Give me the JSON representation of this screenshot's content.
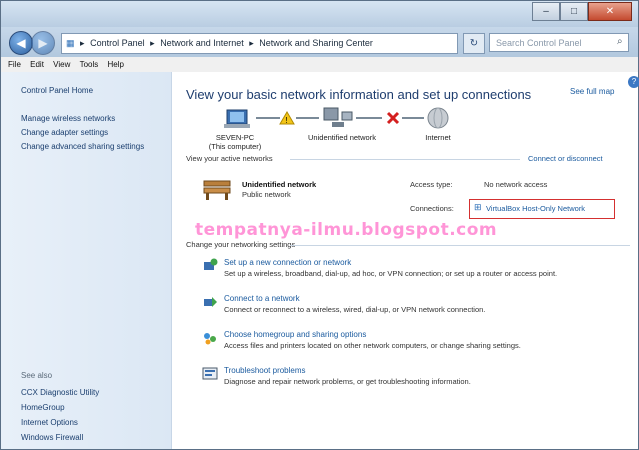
{
  "window": {
    "min": "–",
    "max": "□",
    "close": "✕"
  },
  "nav": {
    "breadcrumbs": [
      "Control Panel",
      "Network and Internet",
      "Network and Sharing Center"
    ],
    "search_placeholder": "Search Control Panel"
  },
  "menu": [
    "File",
    "Edit",
    "View",
    "Tools",
    "Help"
  ],
  "sidebar": {
    "home": "Control Panel Home",
    "links": [
      "Manage wireless networks",
      "Change adapter settings",
      "Change advanced sharing settings"
    ],
    "see_also_label": "See also",
    "see_also": [
      "CCX Diagnostic Utility",
      "HomeGroup",
      "Internet Options",
      "Windows Firewall"
    ]
  },
  "main": {
    "title": "View your basic network information and set up connections",
    "see_full_map": "See full map",
    "map": {
      "computer_name": "SEVEN-PC",
      "computer_sub": "(This computer)",
      "network_label": "Unidentified network",
      "internet_label": "Internet"
    },
    "active_networks_label": "View your active networks",
    "connect_disconnect": "Connect or disconnect",
    "network": {
      "name": "Unidentified network",
      "type": "Public network",
      "access_type_label": "Access type:",
      "access_type_value": "No network access",
      "connections_label": "Connections:",
      "connections_value": "VirtualBox Host-Only Network"
    },
    "watermark": "tempatnya-ilmu.blogspot.com",
    "change_settings_label": "Change your networking settings",
    "tasks": [
      {
        "title": "Set up a new connection or network",
        "desc": "Set up a wireless, broadband, dial-up, ad hoc, or VPN connection; or set up a router or access point."
      },
      {
        "title": "Connect to a network",
        "desc": "Connect or reconnect to a wireless, wired, dial-up, or VPN network connection."
      },
      {
        "title": "Choose homegroup and sharing options",
        "desc": "Access files and printers located on other network computers, or change sharing settings."
      },
      {
        "title": "Troubleshoot problems",
        "desc": "Diagnose and repair network problems, or get troubleshooting information."
      }
    ]
  },
  "colors": {
    "accent": "#1a5a9e",
    "title": "#1e3d6e",
    "highlight_box": "#d43030",
    "watermark": "#ff3fb7"
  }
}
